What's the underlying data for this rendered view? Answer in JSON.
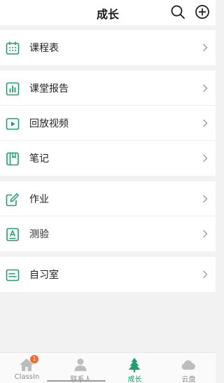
{
  "header": {
    "title": "成长"
  },
  "accent": "#1e9e6a",
  "menu": {
    "group1": [
      {
        "label": "课程表",
        "icon": "calendar-icon"
      }
    ],
    "group2": [
      {
        "label": "课堂报告",
        "icon": "report-icon"
      },
      {
        "label": "回放视频",
        "icon": "play-icon"
      },
      {
        "label": "笔记",
        "icon": "notebook-icon"
      }
    ],
    "group3": [
      {
        "label": "作业",
        "icon": "edit-icon"
      },
      {
        "label": "测验",
        "icon": "quiz-icon"
      }
    ],
    "group4": [
      {
        "label": "自习室",
        "icon": "study-room-icon"
      }
    ]
  },
  "tabbar": {
    "tabs": [
      {
        "label": "ClassIn",
        "icon": "home-icon",
        "badge": "1"
      },
      {
        "label": "联系人",
        "icon": "contacts-icon"
      },
      {
        "label": "成长",
        "icon": "tree-icon",
        "active": true
      },
      {
        "label": "云盘",
        "icon": "cloud-icon"
      }
    ]
  }
}
